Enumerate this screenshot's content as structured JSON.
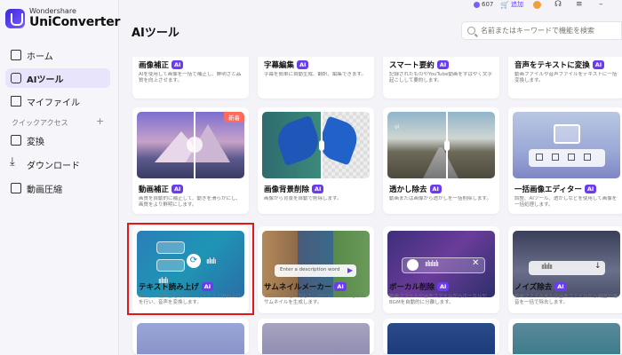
{
  "brand": {
    "sub": "Wondershare",
    "name": "UniConverter"
  },
  "topbar": {
    "coins": "607",
    "add_label": "追加"
  },
  "sidebar": {
    "items": [
      {
        "label": "ホーム"
      },
      {
        "label": "AIツール"
      },
      {
        "label": "マイファイル"
      },
      {
        "label": "変換"
      },
      {
        "label": "ダウンロード"
      },
      {
        "label": "動画圧縮"
      }
    ],
    "quick_access": "クイックアクセス",
    "quick_plus": "+"
  },
  "main": {
    "title": "AIツール",
    "search_placeholder": "名前またはキーワードで機能を検索"
  },
  "ai_badge": "AI",
  "cards_row1": [
    {
      "title": "画像補正",
      "desc": "AIを使用して画像を一括で補正し、鮮明さと品質を向上させます。"
    },
    {
      "title": "字幕編集",
      "desc": "字幕を簡単に自動生成、翻訳、編集できます。"
    },
    {
      "title": "スマート要約",
      "desc": "記録されたものやYouTube動画をすばやく文字起こしして要約します。"
    },
    {
      "title": "音声をテキストに変換",
      "desc": "動画ファイルや音声ファイルをテキストに一括変換します。"
    }
  ],
  "cards_row2": [
    {
      "title": "動画補正",
      "desc": "画質を自動的に補正して、動きを滑らかにし、画質をより鮮明にします。",
      "tag": "新着"
    },
    {
      "title": "画像背景削除",
      "desc": "画像から背景を自動で削除します。"
    },
    {
      "title": "透かし除去",
      "desc": "動画または画像から透かしを一括削除します。"
    },
    {
      "title": "一括画像エディター",
      "desc": "調整、AIツール、透かしなどを使用して画像を一括処理します。"
    }
  ],
  "cards_row3": [
    {
      "title": "テキスト読み上げ",
      "desc": "AIにより複数言語でリアルなテキスト読み上げを行い、音声を変換します。"
    },
    {
      "title": "サムネイルメーカー",
      "desc": "プロンプトを入力して、パーソナライズされたサムネイルを生成します。",
      "prompt": "Enter a description word"
    },
    {
      "title": "ボーカル削除",
      "desc": "動画ファイルや音声ファイルからボーカルやBGMを自動的に分離します。"
    },
    {
      "title": "ノイズ除去",
      "desc": "動画ファイルまたは音声ファイルから周囲の雑音を一括で除去します。"
    }
  ],
  "colors": {
    "accent": "#6a3cf0",
    "highlight": "#e01818",
    "new_tag": "#ff6a5a"
  }
}
